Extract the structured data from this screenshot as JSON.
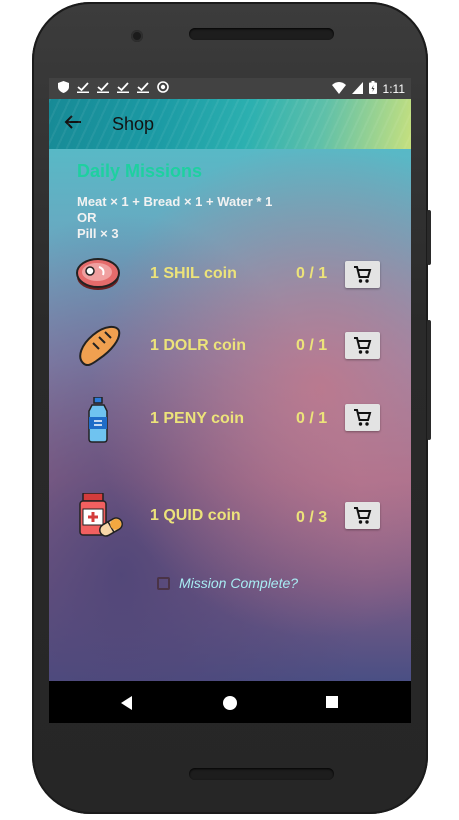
{
  "status_bar": {
    "time": "1:11",
    "left_icons": [
      "shield-icon",
      "check-download-icon",
      "check-download-icon",
      "check-download-icon",
      "check-download-icon",
      "record-icon"
    ],
    "right_icons": [
      "wifi-icon",
      "signal-icon",
      "battery-icon"
    ]
  },
  "appbar": {
    "title": "Shop",
    "back_icon": "arrow-back-icon"
  },
  "missions": {
    "title": "Daily Missions",
    "requirement_line1": "Meat × 1 + Bread × 1 + Water * 1",
    "requirement_line2": "OR",
    "requirement_line3": "Pill × 3",
    "rows": [
      {
        "icon": "meat-icon",
        "label": "1 SHIL coin",
        "count": "0 / 1",
        "progress": 0
      },
      {
        "icon": "bread-icon",
        "label": "1 DOLR coin",
        "count": "0 / 1",
        "progress": 0
      },
      {
        "icon": "water-bottle-icon",
        "label": "1 PENY coin",
        "count": "0 / 1",
        "progress": 0
      },
      {
        "icon": "pill-icon",
        "label": "1 QUID coin",
        "count": "0 / 3",
        "progress": 0
      }
    ],
    "complete_label": "Mission Complete?",
    "complete_checked": false
  },
  "colors": {
    "title_green": "#1ed0a0",
    "coin_yellow": "#ece37a",
    "complete_cyan": "#a8ecf3"
  }
}
